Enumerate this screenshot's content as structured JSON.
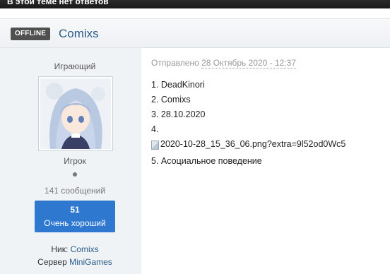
{
  "topbar": {
    "text": "В этой теме нет ответов"
  },
  "post": {
    "status_badge": "OFFLINE",
    "author": "Comixs",
    "posted_prefix": "Отправлено",
    "posted_date": "28 Октябрь 2020 - 12:37",
    "answers": [
      "1. DeadKinori",
      "2. Comixs",
      "3. 28.10.2020",
      "4.",
      "5. Асоциальное поведение"
    ],
    "image_alt": "2020-10-28_15_36_06.png?extra=9l52od0Wc5"
  },
  "sidebar": {
    "group_title": "Играющий",
    "rank": "Игрок",
    "post_count": "141 сообщений",
    "reputation": {
      "value": "51",
      "label": "Очень хороший"
    },
    "nick_label": "Ник:",
    "nick_value": "Comixs",
    "server_label": "Сервер",
    "server_value": "MiniGames"
  },
  "colors": {
    "accent": "#2b5c8a",
    "reputation_bg": "#2f78d0",
    "badge_bg": "#505050",
    "sidebar_bg": "#f0f3f6"
  }
}
